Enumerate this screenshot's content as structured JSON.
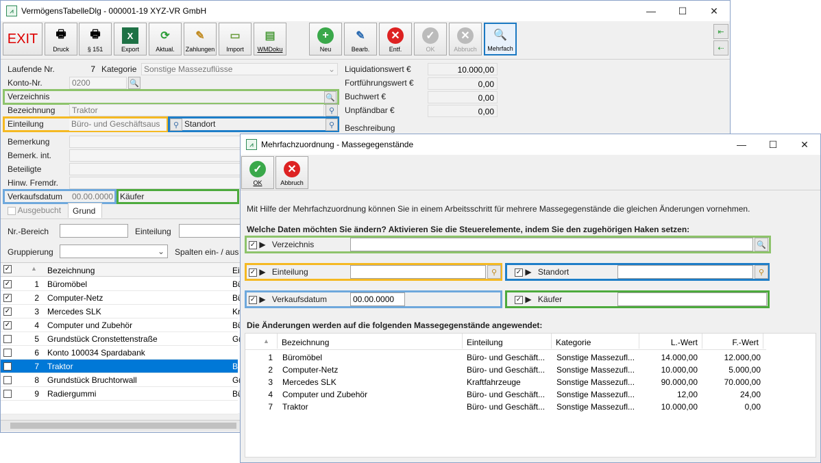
{
  "main": {
    "title": "VermögensTabelleDlg - 000001-19 XYZ-VR GmbH",
    "toolbar": {
      "exit": "EXIT",
      "druck": "Druck",
      "s151": "§ 151",
      "export": "Export",
      "aktual": "Aktual.",
      "zahlungen": "Zahlungen",
      "import": "Import",
      "wmdoku": "WMDoku",
      "neu": "Neu",
      "bearb": "Bearb.",
      "entf": "Entf.",
      "ok": "OK",
      "abbruch": "Abbruch",
      "mehrfach": "Mehrfach"
    },
    "form": {
      "lfd_label": "Laufende Nr.",
      "lfd_value": "7",
      "kategorie_label": "Kategorie",
      "kategorie_value": "Sonstige Massezuflüsse",
      "konto_label": "Konto-Nr.",
      "konto_value": "0200",
      "verzeichnis_label": "Verzeichnis",
      "bezeichnung_label": "Bezeichnung",
      "bezeichnung_value": "Traktor",
      "einteilung_label": "Einteilung",
      "einteilung_value": "Büro- und Geschäftsaus",
      "standort_label": "Standort",
      "bemerkung_label": "Bemerkung",
      "bemerk_int_label": "Bemerk. int.",
      "beteiligte_label": "Beteiligte",
      "hinw_label": "Hinw. Fremdr.",
      "verkaufsdatum_label": "Verkaufsdatum",
      "verkaufsdatum_value": "00.00.0000",
      "kaeufer_label": "Käufer",
      "ausgebucht_label": "Ausgebucht",
      "grund_label": "Grund",
      "liq_label": "Liquidationswert €",
      "liq_value": "10.000,00",
      "fort_label": "Fortführungswert €",
      "fort_value": "0,00",
      "buch_label": "Buchwert €",
      "buch_value": "0,00",
      "unpf_label": "Unpfändbar €",
      "unpf_value": "0,00",
      "beschreibung_label": "Beschreibung"
    },
    "filter": {
      "nrbereich": "Nr.-Bereich",
      "einteilung": "Einteilung",
      "gruppierung": "Gruppierung",
      "spalten": "Spalten ein- / aus"
    },
    "grid": {
      "header_bez": "Bezeichnung",
      "header_ei": "Ei",
      "rows": [
        {
          "checked": true,
          "nr": "1",
          "bez": "Büromöbel",
          "ei": "Bü"
        },
        {
          "checked": true,
          "nr": "2",
          "bez": "Computer-Netz",
          "ei": "Bü"
        },
        {
          "checked": true,
          "nr": "3",
          "bez": "Mercedes SLK",
          "ei": "Kr"
        },
        {
          "checked": true,
          "nr": "4",
          "bez": "Computer und Zubehör",
          "ei": "Bü"
        },
        {
          "checked": false,
          "nr": "5",
          "bez": "Grundstück Cronstettenstraße",
          "ei": "Gr"
        },
        {
          "checked": false,
          "nr": "6",
          "bez": "Konto 100034 Spardabank",
          "ei": ""
        },
        {
          "checked": true,
          "nr": "7",
          "bez": "Traktor",
          "ei": "Bü",
          "selected": true
        },
        {
          "checked": false,
          "nr": "8",
          "bez": "Grundstück Bruchtorwall",
          "ei": "Gr"
        },
        {
          "checked": false,
          "nr": "9",
          "bez": "Radiergummi",
          "ei": "Bü"
        }
      ]
    }
  },
  "dialog": {
    "title": "Mehrfachzuordnung - Massegegenstände",
    "ok": "OK",
    "abbruch": "Abbruch",
    "intro": "Mit Hilfe der Mehrfachzuordnung können Sie in einem Arbeitsschritt für mehrere Massegegenstände die gleichen Änderungen vornehmen.",
    "question": "Welche Daten möchten Sie ändern? Aktivieren Sie die Steuerelemente, indem Sie den zugehörigen Haken setzen:",
    "verzeichnis": "Verzeichnis",
    "einteilung": "Einteilung",
    "standort": "Standort",
    "verkaufsdatum": "Verkaufsdatum",
    "verkaufsdatum_value": "00.00.0000",
    "kaeufer": "Käufer",
    "applied": "Die Änderungen werden auf die folgenden Massegegenstände angewendet:",
    "table": {
      "headers": {
        "bez": "Bezeichnung",
        "ein": "Einteilung",
        "kat": "Kategorie",
        "lwert": "L.-Wert",
        "fwert": "F.-Wert"
      },
      "rows": [
        {
          "nr": "1",
          "bez": "Büromöbel",
          "ein": "Büro- und Geschäft...",
          "kat": "Sonstige Massezufl...",
          "lwert": "14.000,00",
          "fwert": "12.000,00"
        },
        {
          "nr": "2",
          "bez": "Computer-Netz",
          "ein": "Büro- und Geschäft...",
          "kat": "Sonstige Massezufl...",
          "lwert": "10.000,00",
          "fwert": "5.000,00"
        },
        {
          "nr": "3",
          "bez": "Mercedes SLK",
          "ein": "Kraftfahrzeuge",
          "kat": "Sonstige Massezufl...",
          "lwert": "90.000,00",
          "fwert": "70.000,00"
        },
        {
          "nr": "4",
          "bez": "Computer und Zubehör",
          "ein": "Büro- und Geschäft...",
          "kat": "Sonstige Massezufl...",
          "lwert": "12,00",
          "fwert": "24,00"
        },
        {
          "nr": "7",
          "bez": "Traktor",
          "ein": "Büro- und Geschäft...",
          "kat": "Sonstige Massezufl...",
          "lwert": "10.000,00",
          "fwert": "0,00"
        }
      ]
    }
  }
}
